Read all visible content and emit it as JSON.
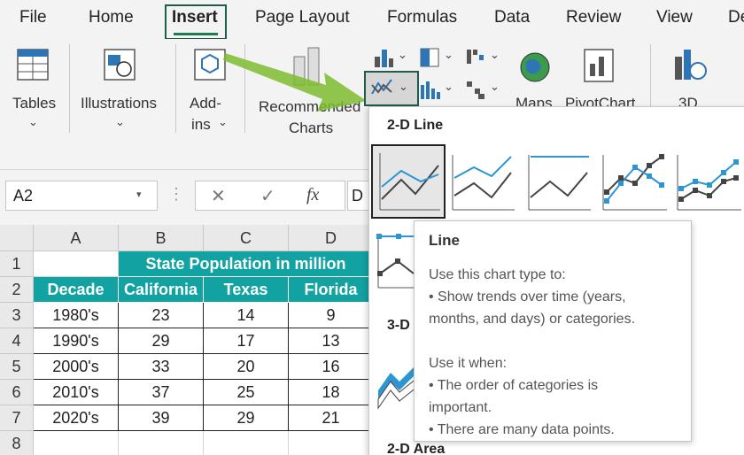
{
  "tabs": [
    "File",
    "Home",
    "Insert",
    "Page Layout",
    "Formulas",
    "Data",
    "Review",
    "View",
    "De"
  ],
  "active_tab": "Insert",
  "ribbon": {
    "tables": "Tables",
    "illustrations": "Illustrations",
    "addins_1": "Add-",
    "addins_2": "ins",
    "recommended_1": "Recommended",
    "recommended_2": "Charts",
    "maps": "Maps",
    "pivotchart": "PivotChart",
    "threed": "3D"
  },
  "formula_bar": {
    "name_box": "A2",
    "fx": "fx",
    "content": "D"
  },
  "sheet": {
    "columns": [
      "A",
      "B",
      "C",
      "D"
    ],
    "rows": [
      "1",
      "2",
      "3",
      "4",
      "5",
      "6",
      "7",
      "8"
    ],
    "title": "State Population in million",
    "headers": [
      "Decade",
      "California",
      "Texas",
      "Florida"
    ],
    "data": [
      [
        "1980's",
        "23",
        "14",
        "9"
      ],
      [
        "1990's",
        "29",
        "17",
        "13"
      ],
      [
        "2000's",
        "33",
        "20",
        "16"
      ],
      [
        "2010's",
        "37",
        "25",
        "18"
      ],
      [
        "2020's",
        "39",
        "29",
        "21"
      ]
    ]
  },
  "dropdown": {
    "section_2d_line": "2-D Line",
    "section_3d": "3-D",
    "section_2d_area": "2-D Area"
  },
  "tooltip": {
    "title": "Line",
    "l1": "Use this chart type to:",
    "l2": "• Show trends over time (years,",
    "l3": "months, and days) or categories.",
    "l4": "Use it when:",
    "l5": "• The order of categories is",
    "l6": "important.",
    "l7": "• There are many data points."
  },
  "colors": {
    "accent_green": "#1f7a52",
    "header_teal": "#12a2a2",
    "arrow_green": "#7dbb2f",
    "chart_blue": "#2e95d3"
  }
}
